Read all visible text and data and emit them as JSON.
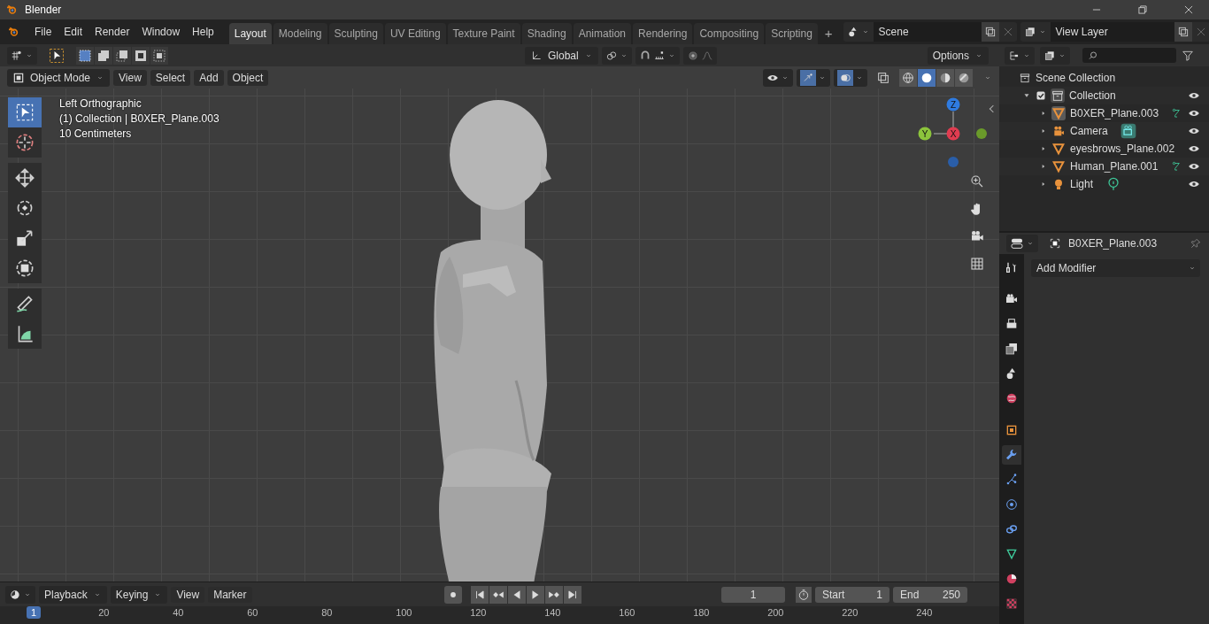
{
  "title_bar": {
    "title": "Blender"
  },
  "menu_bar": {
    "menus": [
      "File",
      "Edit",
      "Render",
      "Window",
      "Help"
    ]
  },
  "workspace_tabs": [
    {
      "label": "Layout",
      "selected": true
    },
    {
      "label": "Modeling",
      "selected": false
    },
    {
      "label": "Sculpting",
      "selected": false
    },
    {
      "label": "UV Editing",
      "selected": false
    },
    {
      "label": "Texture Paint",
      "selected": false
    },
    {
      "label": "Shading",
      "selected": false
    },
    {
      "label": "Animation",
      "selected": false
    },
    {
      "label": "Rendering",
      "selected": false
    },
    {
      "label": "Compositing",
      "selected": false
    },
    {
      "label": "Scripting",
      "selected": false
    }
  ],
  "add_tab": "+",
  "scene": {
    "value": "Scene"
  },
  "view_layer": {
    "value": "View Layer"
  },
  "tool_header": {
    "orientation": "Global",
    "options": "Options"
  },
  "viewport_header": {
    "mode": "Object Mode",
    "menus": [
      "View",
      "Select",
      "Add",
      "Object"
    ],
    "toggles": [
      {
        "kind": "gizmos",
        "on": true
      },
      {
        "kind": "overlays",
        "on": true
      }
    ],
    "shading": [
      {
        "kind": "wireframe",
        "selected": false
      },
      {
        "kind": "solid",
        "selected": true
      },
      {
        "kind": "material",
        "selected": false
      },
      {
        "kind": "rendered",
        "selected": false
      }
    ]
  },
  "viewport": {
    "info": [
      "Left Orthographic",
      "(1) Collection | B0XER_Plane.003",
      "10 Centimeters"
    ],
    "tools": [
      {
        "kind": "select",
        "selected": true
      },
      {
        "kind": "cursor",
        "selected": false
      },
      {
        "kind": "move",
        "selected": false
      },
      {
        "kind": "rotate",
        "selected": false
      },
      {
        "kind": "scale",
        "selected": false
      },
      {
        "kind": "transform",
        "selected": false
      },
      {
        "kind": "annotate",
        "selected": false
      },
      {
        "kind": "measure",
        "selected": false
      }
    ],
    "axes": {
      "z": "Z",
      "y": "Y",
      "x": "X"
    },
    "model": {
      "kind": "picture"
    }
  },
  "outliner": {
    "root": "Scene Collection",
    "collections": [
      {
        "label": "Collection",
        "checked": true,
        "expanded": true,
        "children": [
          {
            "label": "B0XER_Plane.003",
            "kind": "mesh",
            "active": true,
            "extra": {
              "kind": "modifier"
            }
          },
          {
            "label": "Camera",
            "kind": "camera",
            "active": false,
            "extra": {
              "kind": "camera-data"
            }
          },
          {
            "label": "eyesbrows_Plane.002",
            "kind": "mesh",
            "active": false
          },
          {
            "label": "Human_Plane.001",
            "kind": "mesh",
            "active": false,
            "extra": {
              "kind": "modifier"
            }
          },
          {
            "label": "Light",
            "kind": "light",
            "active": false,
            "extra": {
              "kind": "light-data"
            }
          }
        ]
      }
    ]
  },
  "properties": {
    "object_name": "B0XER_Plane.003",
    "add_modifier": "Add Modifier",
    "tabs": [
      {
        "kind": "tool",
        "selected": false
      },
      {
        "kind": "render",
        "selected": false
      },
      {
        "kind": "output",
        "selected": false
      },
      {
        "kind": "view-layer",
        "selected": false
      },
      {
        "kind": "scene",
        "selected": false
      },
      {
        "kind": "world",
        "selected": false
      },
      {
        "kind": "object",
        "selected": false
      },
      {
        "kind": "modifier",
        "selected": true
      },
      {
        "kind": "particles",
        "selected": false
      },
      {
        "kind": "physics",
        "selected": false
      },
      {
        "kind": "constraints",
        "selected": false
      },
      {
        "kind": "data",
        "selected": false
      },
      {
        "kind": "material",
        "selected": false
      },
      {
        "kind": "texture",
        "selected": false
      }
    ]
  },
  "timeline": {
    "menus": [
      {
        "label": "Playback",
        "kind": "dropdown"
      },
      {
        "label": "Keying",
        "kind": "dropdown"
      },
      {
        "label": "View",
        "kind": "menu"
      },
      {
        "label": "Marker",
        "kind": "menu"
      }
    ],
    "current_frame": "1",
    "start_label": "Start",
    "start": "1",
    "end_label": "End",
    "end": "250",
    "playhead": "1",
    "ruler": [
      "20",
      "40",
      "60",
      "80",
      "100",
      "120",
      "140",
      "160",
      "180",
      "200",
      "220",
      "240"
    ]
  }
}
